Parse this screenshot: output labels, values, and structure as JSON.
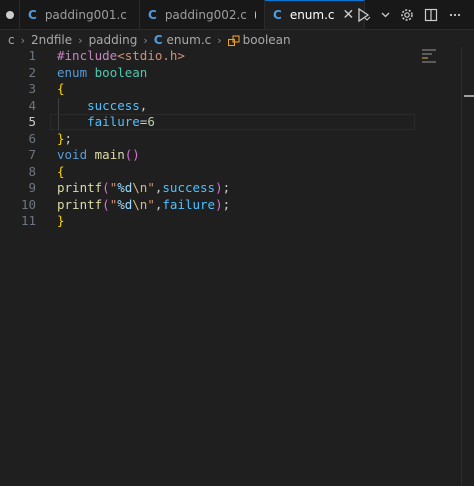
{
  "tabs": [
    {
      "label": "",
      "state": "modified"
    },
    {
      "label": "padding001.c",
      "icon": "C",
      "state": "normal"
    },
    {
      "label": "padding002.c",
      "icon": "C",
      "state": "modified"
    },
    {
      "label": "enum.c",
      "icon": "C",
      "state": "active"
    }
  ],
  "tab_close_glyph": "✕",
  "breadcrumb": {
    "items": [
      "c",
      "2ndfile",
      "padding"
    ],
    "file_icon": "C",
    "file": "enum.c",
    "symbol": "boolean"
  },
  "editor": {
    "current_line": 5,
    "line_numbers": [
      "1",
      "2",
      "3",
      "4",
      "5",
      "6",
      "7",
      "8",
      "9",
      "10",
      "11"
    ],
    "lines": [
      [
        {
          "t": "#include",
          "c": "kw-pre"
        },
        {
          "t": "<stdio.h>",
          "c": "inc"
        }
      ],
      [
        {
          "t": "enum",
          "c": "kw"
        },
        {
          "t": " ",
          "c": "plain"
        },
        {
          "t": "boolean",
          "c": "type"
        }
      ],
      [
        {
          "t": "{",
          "c": "brace"
        }
      ],
      [
        {
          "t": "    ",
          "c": "plain"
        },
        {
          "t": "success",
          "c": "ident"
        },
        {
          "t": ",",
          "c": "plain"
        }
      ],
      [
        {
          "t": "    ",
          "c": "plain"
        },
        {
          "t": "failure",
          "c": "ident"
        },
        {
          "t": "=",
          "c": "plain"
        },
        {
          "t": "6",
          "c": "num"
        }
      ],
      [
        {
          "t": "}",
          "c": "brace"
        },
        {
          "t": ";",
          "c": "plain"
        }
      ],
      [
        {
          "t": "void",
          "c": "kw"
        },
        {
          "t": " ",
          "c": "plain"
        },
        {
          "t": "main",
          "c": "fn"
        },
        {
          "t": "()",
          "c": "paren"
        }
      ],
      [
        {
          "t": "{",
          "c": "brace"
        }
      ],
      [
        {
          "t": "printf",
          "c": "fn"
        },
        {
          "t": "(",
          "c": "paren"
        },
        {
          "t": "\"",
          "c": "str"
        },
        {
          "t": "%d",
          "c": "var"
        },
        {
          "t": "\\n",
          "c": "esc"
        },
        {
          "t": "\"",
          "c": "str"
        },
        {
          "t": ",",
          "c": "plain"
        },
        {
          "t": "success",
          "c": "ident"
        },
        {
          "t": ")",
          "c": "paren"
        },
        {
          "t": ";",
          "c": "plain"
        }
      ],
      [
        {
          "t": "printf",
          "c": "fn"
        },
        {
          "t": "(",
          "c": "paren"
        },
        {
          "t": "\"",
          "c": "str"
        },
        {
          "t": "%d",
          "c": "var"
        },
        {
          "t": "\\n",
          "c": "esc"
        },
        {
          "t": "\"",
          "c": "str"
        },
        {
          "t": ",",
          "c": "plain"
        },
        {
          "t": "failure",
          "c": "ident"
        },
        {
          "t": ")",
          "c": "paren"
        },
        {
          "t": ";",
          "c": "plain"
        }
      ],
      [
        {
          "t": "}",
          "c": "brace"
        }
      ]
    ]
  },
  "toolbar_icons": [
    "run-icon",
    "chevron-down-icon",
    "gear-icon",
    "split-editor-icon",
    "more-icon"
  ],
  "colors": {
    "accent": "#0078d4",
    "c_icon": "#4d9de0",
    "background": "#1f1f1f"
  }
}
